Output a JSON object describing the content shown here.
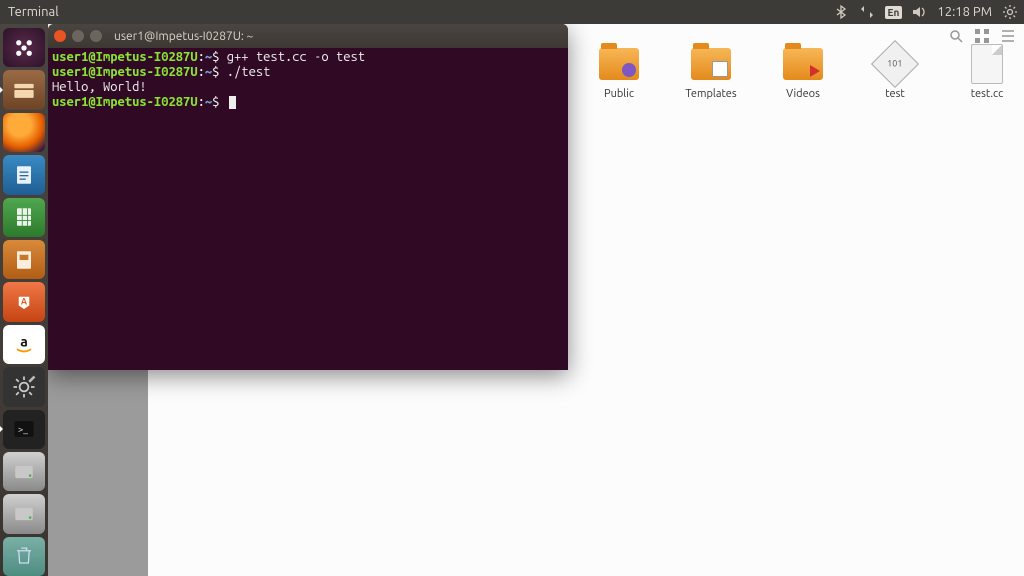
{
  "menubar": {
    "app_title": "Terminal",
    "lang": "En",
    "time": "12:18 PM"
  },
  "launcher": {
    "items": [
      {
        "name": "dash",
        "tip": "Dash"
      },
      {
        "name": "files",
        "tip": "Files"
      },
      {
        "name": "firefox",
        "tip": "Firefox"
      },
      {
        "name": "writer",
        "tip": "LibreOffice Writer"
      },
      {
        "name": "calc",
        "tip": "LibreOffice Calc"
      },
      {
        "name": "impress",
        "tip": "LibreOffice Impress"
      },
      {
        "name": "software",
        "tip": "Ubuntu Software"
      },
      {
        "name": "amazon",
        "tip": "Amazon"
      },
      {
        "name": "settings",
        "tip": "System Settings"
      },
      {
        "name": "terminal",
        "tip": "Terminal"
      },
      {
        "name": "disk1",
        "tip": "Disk"
      },
      {
        "name": "disk2",
        "tip": "Disk"
      },
      {
        "name": "trash",
        "tip": "Trash"
      }
    ]
  },
  "terminal": {
    "title": "user1@Impetus-I0287U: ~",
    "prompt_user": "user1@Impetus-I0287U",
    "prompt_path": "~",
    "lines": [
      {
        "cmd": "g++ test.cc -o test"
      },
      {
        "cmd": "./test"
      },
      {
        "out": "Hello, World!"
      },
      {
        "cmd": ""
      }
    ]
  },
  "desktop": {
    "icons": [
      {
        "label": "Public",
        "kind": "folder-public"
      },
      {
        "label": "Templates",
        "kind": "folder-templates"
      },
      {
        "label": "Videos",
        "kind": "folder-videos"
      },
      {
        "label": "test",
        "kind": "exec"
      },
      {
        "label": "test.cc",
        "kind": "doc"
      }
    ]
  }
}
